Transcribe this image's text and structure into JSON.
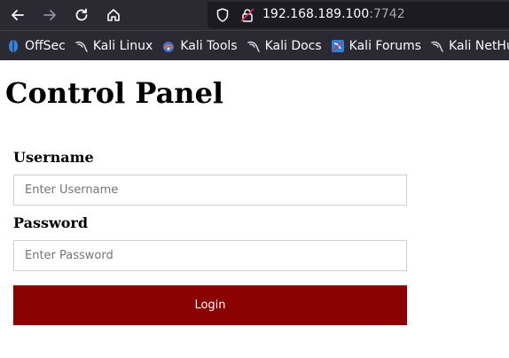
{
  "browser": {
    "url_host": "192.168.189.100",
    "url_port": ":7742",
    "bookmarks": [
      {
        "label": "OffSec",
        "icon": "offsec-icon"
      },
      {
        "label": "Kali Linux",
        "icon": "kali-dragon-icon"
      },
      {
        "label": "Kali Tools",
        "icon": "kali-tools-icon"
      },
      {
        "label": "Kali Docs",
        "icon": "kali-dragon-icon"
      },
      {
        "label": "Kali Forums",
        "icon": "kali-forums-icon"
      },
      {
        "label": "Kali NetHun",
        "icon": "kali-dragon-icon"
      }
    ]
  },
  "page": {
    "title": "Control Panel",
    "username_label": "Username",
    "username_placeholder": "Enter Username",
    "password_label": "Password",
    "password_placeholder": "Enter Password",
    "login_label": "Login"
  },
  "colors": {
    "chrome_bg": "#2b2a33",
    "urlbar_bg": "#1c1b22",
    "login_button": "#8b0000"
  }
}
